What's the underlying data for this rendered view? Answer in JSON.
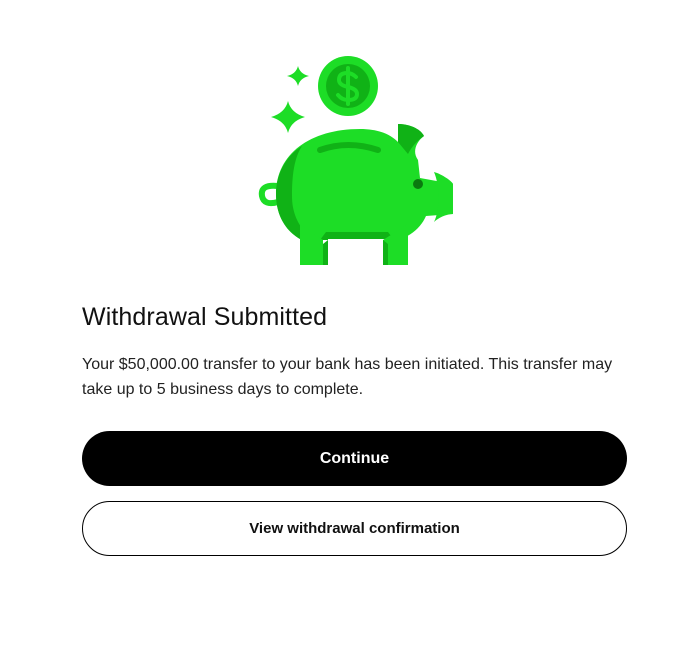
{
  "illustration": {
    "icon": "piggy-bank-with-dollar-coin-icon",
    "colors": {
      "bright_green": "#1DDD26",
      "dark_green": "#10B216"
    }
  },
  "dialog": {
    "title": "Withdrawal Submitted",
    "message": "Your $50,000.00 transfer to your bank has been initiated. This transfer may take up to 5 business days to complete."
  },
  "actions": {
    "continue_label": "Continue",
    "view_confirmation_label": "View withdrawal confirmation"
  }
}
